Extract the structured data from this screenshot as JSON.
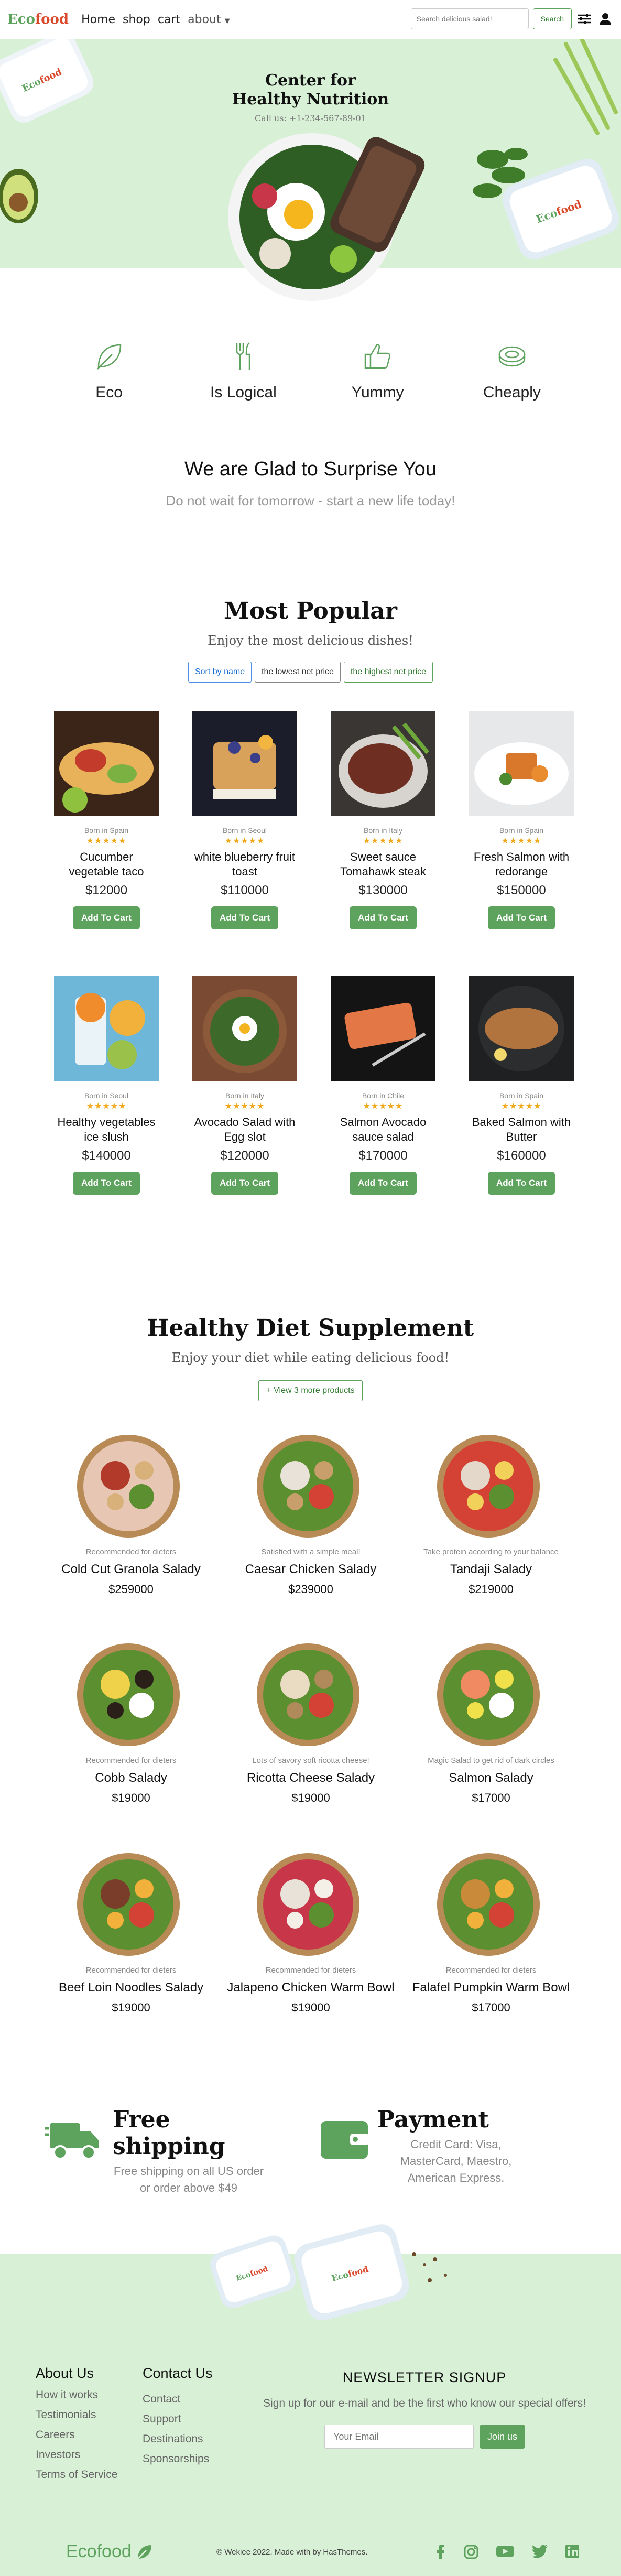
{
  "nav": {
    "logo_eco": "Eco",
    "logo_food": "food",
    "links": [
      "Home",
      "shop",
      "cart",
      "about"
    ],
    "search_placeholder": "Search delicious salad!",
    "search_button": "Search"
  },
  "hero": {
    "title_line1": "Center for",
    "title_line2": "Healthy Nutrition",
    "call": "Call us: +1-234-567-89-01"
  },
  "features": [
    {
      "label": "Eco",
      "icon": "leaf-icon"
    },
    {
      "label": "Is Logical",
      "icon": "fork-knife-icon"
    },
    {
      "label": "Yummy",
      "icon": "thumbs-up-icon"
    },
    {
      "label": "Cheaply",
      "icon": "coin-icon"
    }
  ],
  "intro": {
    "title": "We are Glad to Surprise You",
    "subtitle": "Do not wait for tomorrow - start a new life today!"
  },
  "popular": {
    "title": "Most Popular",
    "subtitle": "Enjoy the most delicious dishes!",
    "filters": [
      "Sort by name",
      "the lowest net price",
      "the highest net price"
    ],
    "add_label": "Add To Cart",
    "stars": "★★★★★",
    "products": [
      {
        "origin": "Born in Spain",
        "name": "Cucumber vegetable taco",
        "price": "$12000"
      },
      {
        "origin": "Born in Seoul",
        "name": "white blueberry fruit toast",
        "price": "$110000"
      },
      {
        "origin": "Born in Italy",
        "name": "Sweet sauce Tomahawk steak",
        "price": "$130000"
      },
      {
        "origin": "Born in Spain",
        "name": "Fresh Salmon with redorange",
        "price": "$150000"
      },
      {
        "origin": "Born in Seoul",
        "name": "Healthy vegetables ice slush",
        "price": "$140000"
      },
      {
        "origin": "Born in Italy",
        "name": "Avocado Salad with Egg slot",
        "price": "$120000"
      },
      {
        "origin": "Born in Chile",
        "name": "Salmon Avocado sauce salad",
        "price": "$170000"
      },
      {
        "origin": "Born in Spain",
        "name": "Baked Salmon with Butter",
        "price": "$160000"
      }
    ]
  },
  "diet": {
    "title": "Healthy Diet Supplement",
    "subtitle": "Enjoy your diet while eating delicious food!",
    "view_more": "+ View 3 more products",
    "items": [
      {
        "sub": "Recommended for dieters",
        "name": "Cold Cut Granola Salady",
        "price": "$259000"
      },
      {
        "sub": "Satisfied with a simple meal!",
        "name": "Caesar Chicken Salady",
        "price": "$239000"
      },
      {
        "sub": "Take protein according to your balance",
        "name": "Tandaji Salady",
        "price": "$219000"
      },
      {
        "sub": "Recommended for dieters",
        "name": "Cobb Salady",
        "price": "$19000"
      },
      {
        "sub": "Lots of savory soft ricotta cheese!",
        "name": "Ricotta Cheese Salady",
        "price": "$19000"
      },
      {
        "sub": "Magic Salad to get rid of dark circles",
        "name": "Salmon Salady",
        "price": "$17000"
      },
      {
        "sub": "Recommended for dieters",
        "name": "Beef Loin Noodles Salady",
        "price": "$19000"
      },
      {
        "sub": "Recommended for dieters",
        "name": "Jalapeno Chicken Warm Bowl",
        "price": "$19000"
      },
      {
        "sub": "Recommended for dieters",
        "name": "Falafel Pumpkin Warm Bowl",
        "price": "$17000"
      }
    ]
  },
  "promo": {
    "shipping_title": "Free shipping",
    "shipping_desc": "Free shipping on all US order or order above $49",
    "payment_title": "Payment",
    "payment_desc": "Credit Card: Visa, MasterCard, Maestro, American Express."
  },
  "footer": {
    "about_title": "About Us",
    "about_links": [
      "How it works",
      "Testimonials",
      "Careers",
      "Investors",
      "Terms of Service"
    ],
    "contact_title": "Contact Us",
    "contact_links": [
      "Contact",
      "Support",
      "Destinations",
      "Sponsorships"
    ],
    "news_title": "NEWSLETTER SIGNUP",
    "news_text": "Sign up for our e-mail and be the first who know our special offers!",
    "email_placeholder": "Your Email",
    "join_label": "Join us",
    "logo": "Ecofood",
    "copyright": "© Wekiee 2022. Made with by HasThemes."
  },
  "colors": {
    "accent": "#5da35d",
    "hero_bg": "#d8f0d6",
    "logo_food": "#d9492b",
    "stars": "#f0a818"
  }
}
